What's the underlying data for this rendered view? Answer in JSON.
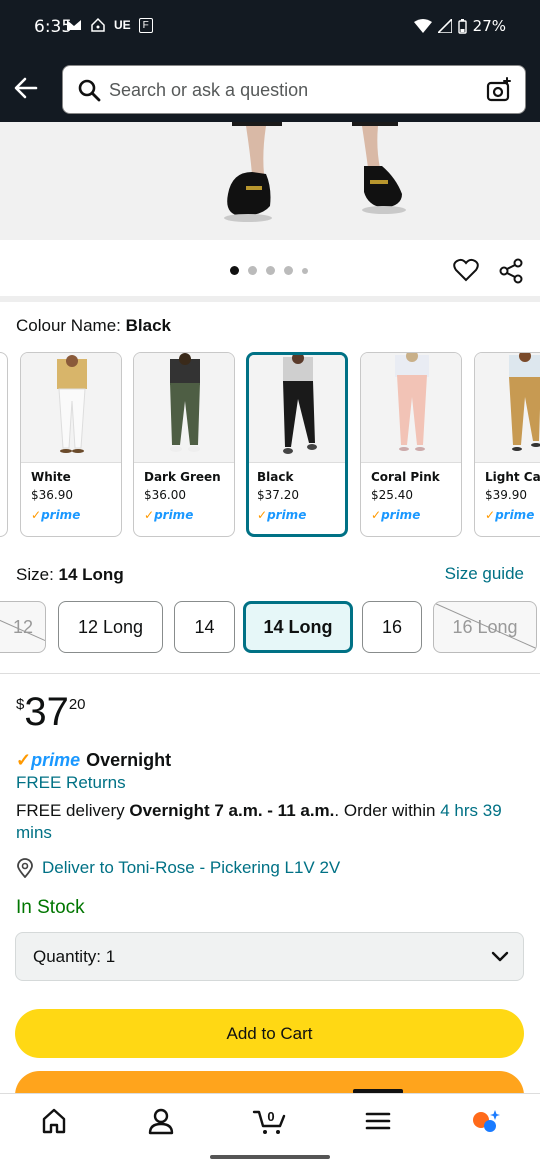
{
  "status_bar": {
    "time": "6:35",
    "carrier": "UE",
    "badge": "F",
    "battery": "27%"
  },
  "search": {
    "placeholder": "Search or ask a question"
  },
  "colour": {
    "label": "Colour Name: ",
    "value": "Black"
  },
  "swatches": [
    {
      "name": "White",
      "price": "$36.90",
      "prime": "prime"
    },
    {
      "name": "Dark Green",
      "price": "$36.00",
      "prime": "prime"
    },
    {
      "name": "Black",
      "price": "$37.20",
      "prime": "prime"
    },
    {
      "name": "Coral Pink",
      "price": "$25.40",
      "prime": "prime"
    },
    {
      "name": "Light Cam",
      "price": "$39.90",
      "prime": "prime"
    }
  ],
  "size": {
    "label": "Size: ",
    "value": "14 Long",
    "guide": "Size guide"
  },
  "sizes": [
    "12",
    "12 Long",
    "14",
    "14 Long",
    "16",
    "16 Long"
  ],
  "price": {
    "currency": "$",
    "whole": "37",
    "fraction": "20"
  },
  "prime_delivery": {
    "prime": "prime",
    "speed": "Overnight"
  },
  "free_returns": "FREE Returns",
  "delivery": {
    "prefix": "FREE delivery ",
    "window": "Overnight 7 a.m. - 11 a.m.",
    "mid": ". Order within ",
    "countdown": "4 hrs 39 mins"
  },
  "deliver_to": "Deliver to Toni-Rose - Pickering L1V 2V",
  "stock": "In Stock",
  "quantity": "Quantity:  1",
  "add_to_cart": "Add to Cart",
  "colors": {
    "header": "#131a22",
    "link": "#007185",
    "add_to_cart": "#ffd814",
    "buy_now": "#ffa41c",
    "in_stock": "#007600"
  }
}
